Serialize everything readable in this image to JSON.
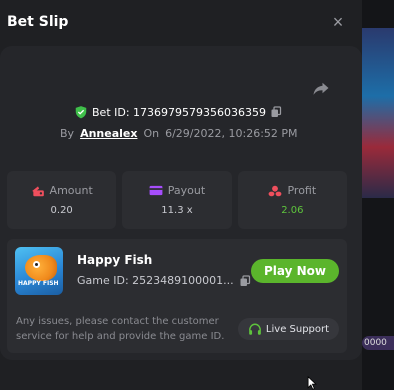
{
  "modal": {
    "title": "Bet Slip",
    "close_icon": "×"
  },
  "bet": {
    "id_text": "Bet ID: 1736979579356036359",
    "by_label": "By",
    "user": "Annealex",
    "on_label": "On",
    "datetime": "6/29/2022, 10:26:52 PM"
  },
  "stats": [
    {
      "label": "Amount",
      "value": "0.20",
      "icon": "wallet-icon",
      "icon_color": "#ef4f5d"
    },
    {
      "label": "Payout",
      "value": "11.3 x",
      "icon": "card-icon",
      "icon_color": "#a64dfc"
    },
    {
      "label": "Profit",
      "value": "2.06",
      "icon": "coins-icon",
      "icon_color": "#ef4f5d",
      "value_color": "#5ec43c"
    }
  ],
  "game": {
    "name": "Happy Fish",
    "id_text": "Game ID: 2523489100001...",
    "thumb_text": "HAPPY FISH",
    "play_label": "Play Now"
  },
  "support": {
    "message": "Any issues, please contact the customer service for help and provide the game ID.",
    "button_label": "Live Support"
  },
  "colors": {
    "accent_green": "#5bb52c",
    "profit_green": "#5ec43c",
    "shield_green": "#3fbf4a"
  }
}
